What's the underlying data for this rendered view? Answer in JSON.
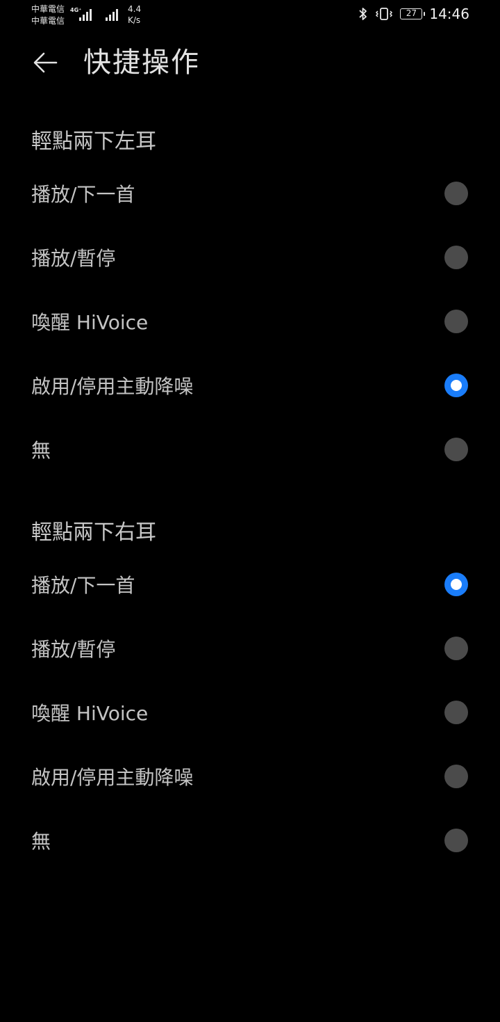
{
  "status_bar": {
    "carrier_1": "中華電信",
    "carrier_2": "中華電信",
    "network_type": "4G⁺",
    "speed_value": "4.4",
    "speed_unit": "K/s",
    "battery_level": "27",
    "time": "14:46",
    "icons": [
      "signal-icon",
      "bluetooth-icon",
      "vibrate-icon",
      "battery-icon"
    ]
  },
  "header": {
    "back_icon": "arrow-left-icon",
    "title": "快捷操作"
  },
  "sections": [
    {
      "title": "輕點兩下左耳",
      "options": [
        {
          "label": "播放/下一首",
          "selected": false
        },
        {
          "label": "播放/暫停",
          "selected": false
        },
        {
          "label": "喚醒 HiVoice",
          "selected": false
        },
        {
          "label": "啟用/停用主動降噪",
          "selected": true
        },
        {
          "label": "無",
          "selected": false
        }
      ]
    },
    {
      "title": "輕點兩下右耳",
      "options": [
        {
          "label": "播放/下一首",
          "selected": true
        },
        {
          "label": "播放/暫停",
          "selected": false
        },
        {
          "label": "喚醒 HiVoice",
          "selected": false
        },
        {
          "label": "啟用/停用主動降噪",
          "selected": false
        },
        {
          "label": "無",
          "selected": false
        }
      ]
    }
  ],
  "colors": {
    "background": "#000000",
    "accent": "#1a7dfa",
    "radio_off": "#4b4b4b",
    "text": "#c4c4c4"
  }
}
